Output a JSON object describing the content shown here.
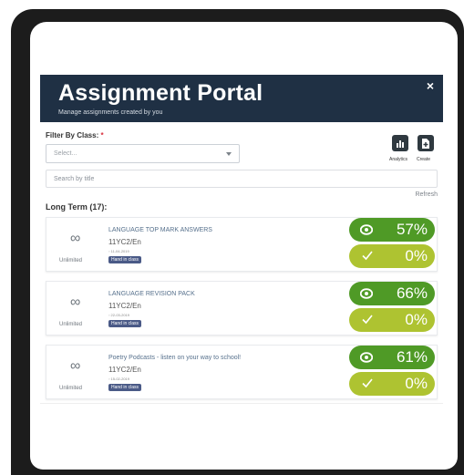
{
  "header": {
    "title": "Assignment Portal",
    "subtitle": "Manage assignments created by you",
    "close_glyph": "×"
  },
  "filter": {
    "label": "Filter By Class:",
    "required_mark": "*",
    "select_placeholder": "Select..."
  },
  "toolbar": {
    "analytics_label": "Analytics",
    "create_label": "Create"
  },
  "search": {
    "placeholder": "Search by title"
  },
  "refresh_label": "Refresh",
  "section": {
    "title": "Long Term (17):"
  },
  "assignments": [
    {
      "due": "Unlimited",
      "title": "LANGUAGE TOP MARK ANSWERS",
      "class": "11YC2/En",
      "date": "11-04-2019",
      "badge": "Hand in class",
      "viewed": "57%",
      "completed": "0%",
      "viewed_value": 57,
      "completed_value": 0
    },
    {
      "due": "Unlimited",
      "title": "LANGUAGE REVISION PACK",
      "class": "11YC2/En",
      "date": "22-03-2019",
      "badge": "Hand in class",
      "viewed": "66%",
      "completed": "0%",
      "viewed_value": 66,
      "completed_value": 0
    },
    {
      "due": "Unlimited",
      "title": "Poetry Podcasts - listen on your way to school!",
      "class": "11YC2/En",
      "date": "15-02-2019",
      "badge": "Hand in class",
      "viewed": "61%",
      "completed": "0%",
      "viewed_value": 61,
      "completed_value": 0
    }
  ],
  "icons": {
    "close": "close-icon",
    "analytics": "bar-chart-icon",
    "create": "file-add-icon",
    "unlimited": "infinity-icon",
    "viewed": "eye-icon",
    "completed": "check-icon",
    "date": "calendar-icon",
    "dropdown": "chevron-down-icon"
  },
  "colors": {
    "header_bg": "#1f3044",
    "viewed_pill": "#4f9a26",
    "completed_pill": "#aec331",
    "badge": "#4a5a87",
    "required": "#d9303e"
  }
}
